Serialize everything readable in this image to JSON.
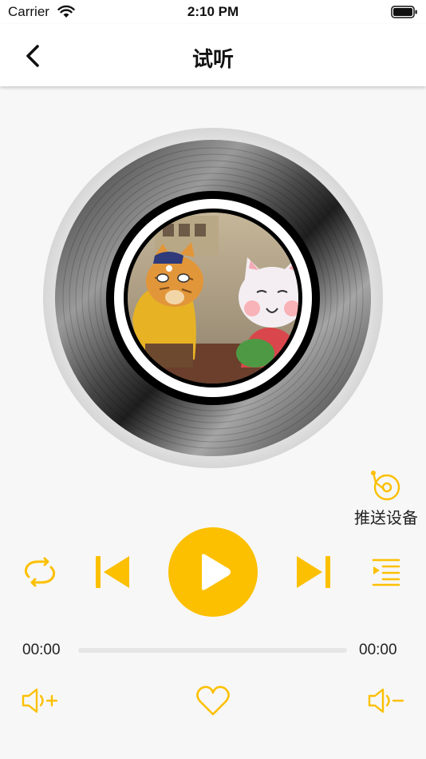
{
  "status_bar": {
    "carrier": "Carrier",
    "time": "2:10 PM",
    "wifi_icon": "wifi-icon",
    "battery_icon": "battery-full-icon"
  },
  "nav": {
    "title": "试听",
    "back_icon": "chevron-left-icon"
  },
  "player": {
    "artwork": "vinyl-record-with-cat-illustration",
    "push_device": {
      "label": "推送设备",
      "icon": "record-player-icon"
    },
    "controls": {
      "repeat_icon": "repeat-icon",
      "previous_icon": "skip-previous-icon",
      "play_icon": "play-icon",
      "next_icon": "skip-next-icon",
      "playlist_icon": "playlist-icon"
    },
    "progress": {
      "current_time": "00:00",
      "total_time": "00:00",
      "fraction": 0
    },
    "bottom": {
      "volume_up_icon": "volume-up-icon",
      "favorite_icon": "heart-icon",
      "volume_down_icon": "volume-down-icon"
    }
  },
  "colors": {
    "accent": "#fcc000",
    "background": "#f7f7f7"
  }
}
